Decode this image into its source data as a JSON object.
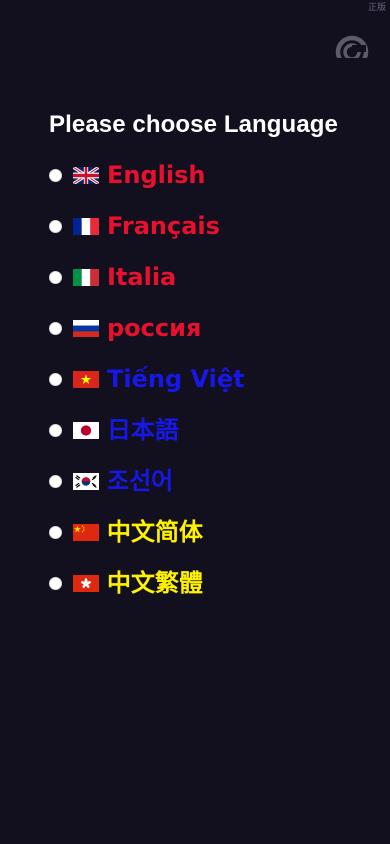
{
  "corner_tag": "正版",
  "reload_icon": "refresh-icon",
  "title": "Please choose Language",
  "languages": [
    {
      "label": "English",
      "flag": "flag-uk-icon",
      "color": "#e8112d"
    },
    {
      "label": "Français",
      "flag": "flag-france-icon",
      "color": "#e8112d"
    },
    {
      "label": "Italia",
      "flag": "flag-italy-icon",
      "color": "#e8112d"
    },
    {
      "label": "россия",
      "flag": "flag-russia-icon",
      "color": "#e8112d"
    },
    {
      "label": "Tiếng Việt",
      "flag": "flag-vietnam-icon",
      "color": "#1717e8"
    },
    {
      "label": "日本語",
      "flag": "flag-japan-icon",
      "color": "#1717e8"
    },
    {
      "label": "조선어",
      "flag": "flag-korea-icon",
      "color": "#1717e8"
    },
    {
      "label": "中文简体",
      "flag": "flag-china-icon",
      "color": "#fff200"
    },
    {
      "label": "中文繁體",
      "flag": "flag-hongkong-icon",
      "color": "#fff200"
    }
  ]
}
